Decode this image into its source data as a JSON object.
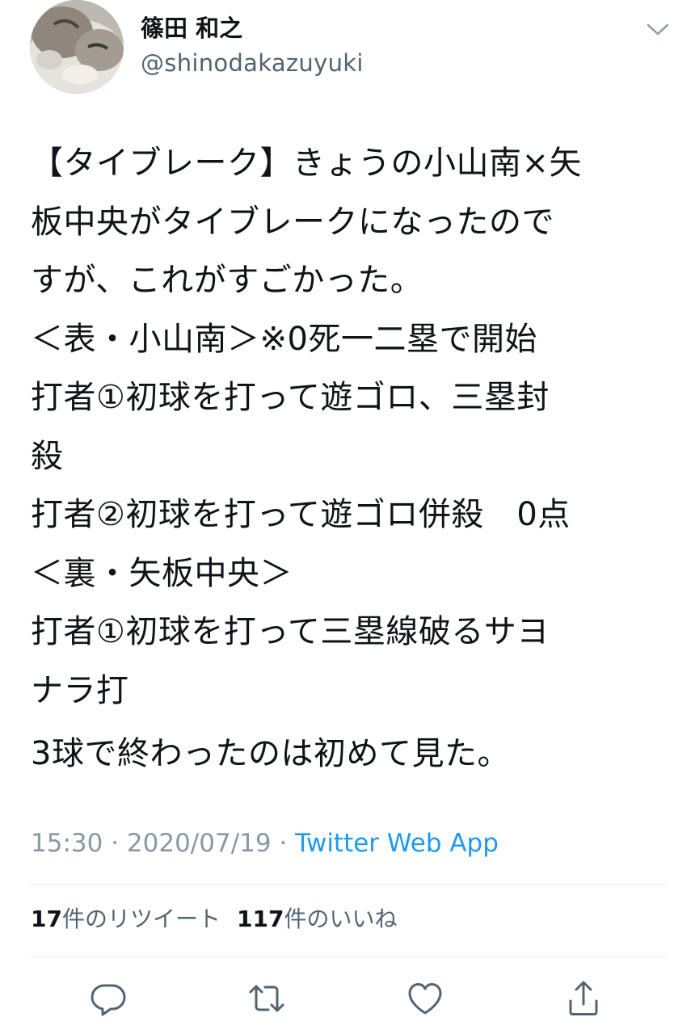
{
  "author": {
    "display_name": "篠田 和之",
    "handle": "@shinodakazuyuki",
    "avatar_icon": "cat-avatar-icon",
    "menu_icon": "chevron-down-icon"
  },
  "tweet": {
    "lines": [
      "【タイブレーク】きょうの小山南×矢",
      "板中央がタイブレークになったので",
      "すが、これがすごかった。",
      "＜表・小山南＞※0死一二塁で開始",
      "打者①初球を打って遊ゴロ、三塁封",
      "殺",
      "打者②初球を打って遊ゴロ併殺　0点",
      "＜裏・矢板中央＞",
      "打者①初球を打って三塁線破るサヨ",
      "ナラ打"
    ],
    "closing_line": "3球で終わったのは初めて見た。"
  },
  "meta": {
    "time": "15:30",
    "separator": " · ",
    "date": "2020/07/19",
    "source": "Twitter Web App"
  },
  "stats": {
    "retweets_count": "17",
    "retweets_label": "件のリツイート",
    "likes_count": "117",
    "likes_label": "件のいいね"
  },
  "actions": {
    "reply_icon": "reply-icon",
    "retweet_icon": "retweet-icon",
    "like_icon": "heart-icon",
    "share_icon": "share-icon"
  },
  "colors": {
    "text": "#0f1419",
    "secondary": "#536471",
    "meta_gray": "#8899a6",
    "link_blue": "#1d9bf0",
    "divider": "#e1e8ed",
    "icon_gray": "#536471"
  }
}
